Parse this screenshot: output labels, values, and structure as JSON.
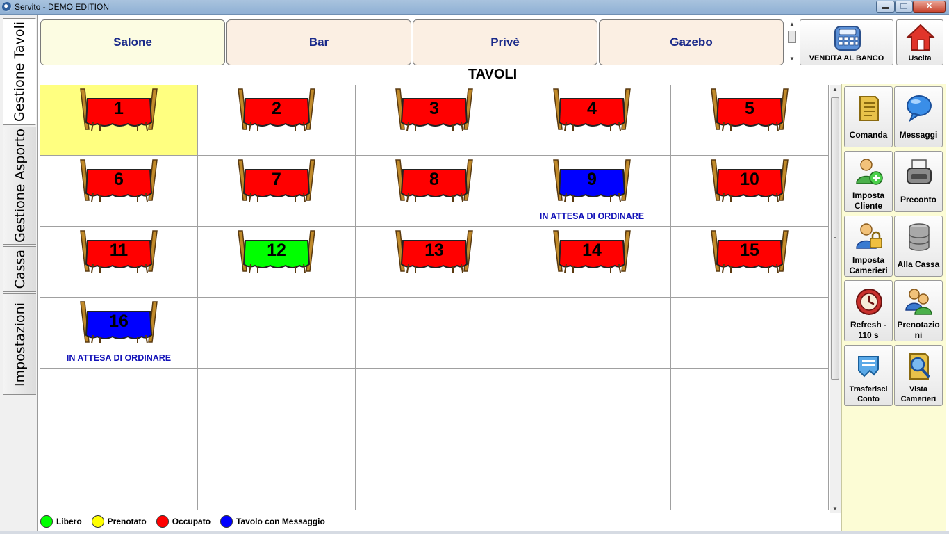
{
  "window": {
    "title": "Servito - DEMO EDITION"
  },
  "left_tabs": [
    {
      "label": "Gestione Tavoli",
      "active": true
    },
    {
      "label": "Gestione Asporto",
      "active": false
    },
    {
      "label": "Cassa",
      "active": false
    },
    {
      "label": "Impostazioni",
      "active": false
    }
  ],
  "rooms": [
    {
      "label": "Salone",
      "selected": true
    },
    {
      "label": "Bar",
      "selected": false
    },
    {
      "label": "Privè",
      "selected": false
    },
    {
      "label": "Gazebo",
      "selected": false
    }
  ],
  "top_buttons": {
    "vendita": "VENDITA AL BANCO",
    "uscita": "Uscita"
  },
  "heading": "TAVOLI",
  "colors": {
    "occupied": "#ff0000",
    "free": "#00ff00",
    "reserved": "#ffff00",
    "message": "#0000ff"
  },
  "tables": [
    {
      "number": "1",
      "color": "#ff0000",
      "reserved": true,
      "status": ""
    },
    {
      "number": "2",
      "color": "#ff0000",
      "reserved": false,
      "status": ""
    },
    {
      "number": "3",
      "color": "#ff0000",
      "reserved": false,
      "status": ""
    },
    {
      "number": "4",
      "color": "#ff0000",
      "reserved": false,
      "status": ""
    },
    {
      "number": "5",
      "color": "#ff0000",
      "reserved": false,
      "status": ""
    },
    {
      "number": "6",
      "color": "#ff0000",
      "reserved": false,
      "status": ""
    },
    {
      "number": "7",
      "color": "#ff0000",
      "reserved": false,
      "status": ""
    },
    {
      "number": "8",
      "color": "#ff0000",
      "reserved": false,
      "status": ""
    },
    {
      "number": "9",
      "color": "#0000ff",
      "reserved": false,
      "status": "IN ATTESA DI ORDINARE"
    },
    {
      "number": "10",
      "color": "#ff0000",
      "reserved": false,
      "status": ""
    },
    {
      "number": "11",
      "color": "#ff0000",
      "reserved": false,
      "status": ""
    },
    {
      "number": "12",
      "color": "#00ff00",
      "reserved": false,
      "status": ""
    },
    {
      "number": "13",
      "color": "#ff0000",
      "reserved": false,
      "status": ""
    },
    {
      "number": "14",
      "color": "#ff0000",
      "reserved": false,
      "status": ""
    },
    {
      "number": "15",
      "color": "#ff0000",
      "reserved": false,
      "status": ""
    },
    {
      "number": "16",
      "color": "#0000ff",
      "reserved": false,
      "status": "IN ATTESA DI ORDINARE"
    }
  ],
  "side_buttons": {
    "comanda": [
      "Comanda"
    ],
    "messaggi": [
      "Messaggi"
    ],
    "imposta_cliente": [
      "Imposta",
      "Cliente"
    ],
    "preconto": [
      "Preconto"
    ],
    "imposta_camerieri": [
      "Imposta",
      "Camerieri"
    ],
    "alla_cassa": [
      "Alla Cassa"
    ],
    "refresh": [
      "Refresh -",
      "110 s"
    ],
    "prenotazioni": [
      "Prenotazio",
      "ni"
    ],
    "trasferisci": [
      "Trasferisci",
      "Conto"
    ],
    "vista_camerieri": [
      "Vista",
      "Camerieri"
    ]
  },
  "legend": [
    {
      "label": "Libero",
      "color": "#00ff00"
    },
    {
      "label": "Prenotato",
      "color": "#ffff00"
    },
    {
      "label": "Occupato",
      "color": "#ff0000"
    },
    {
      "label": "Tavolo con Messaggio",
      "color": "#0000ff"
    }
  ]
}
